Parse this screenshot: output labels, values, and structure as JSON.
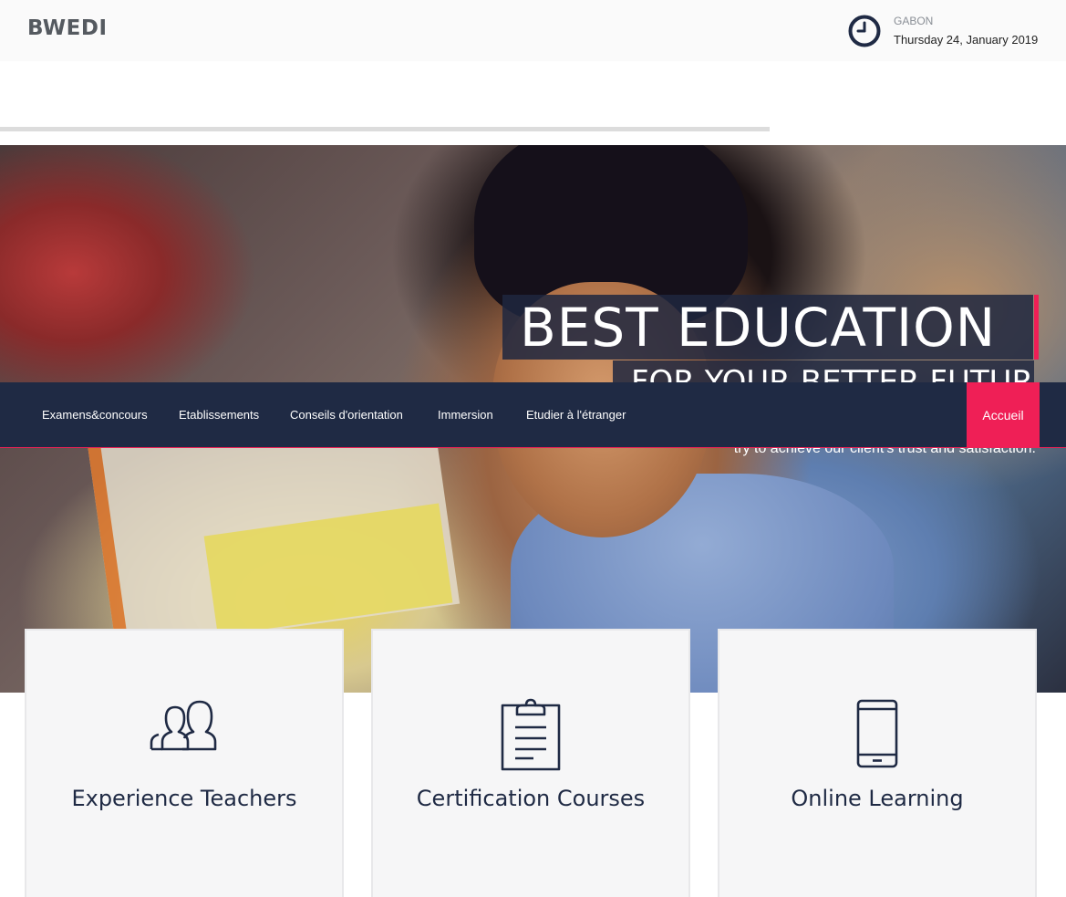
{
  "header": {
    "brand": "BWEDI",
    "location": "GABON",
    "date": "Thursday 24, January 2019"
  },
  "icons": {
    "clock": "clock-icon",
    "teachers": "users-icon",
    "courses": "clipboard-icon",
    "online": "smartphone-icon"
  },
  "colors": {
    "navy": "#1f2a44",
    "accent": "#ef1f56",
    "topbar_bg": "#fafafa",
    "card_bg": "#f6f6f7"
  },
  "hero": {
    "title": "BEST EDUCATION",
    "subtitle": "FOR YOUR BETTER FUTURE",
    "tagline": "try to achieve our client's trust and satisfaction."
  },
  "nav": {
    "items": [
      {
        "label": "Examens&concours"
      },
      {
        "label": "Etablissements"
      },
      {
        "label": "Conseils d'orientation"
      },
      {
        "label": "Immersion"
      },
      {
        "label": "Etudier à l'étranger"
      }
    ],
    "active": "Accueil"
  },
  "features": [
    {
      "title": "Experience Teachers"
    },
    {
      "title": "Certification Courses"
    },
    {
      "title": "Online Learning"
    }
  ]
}
